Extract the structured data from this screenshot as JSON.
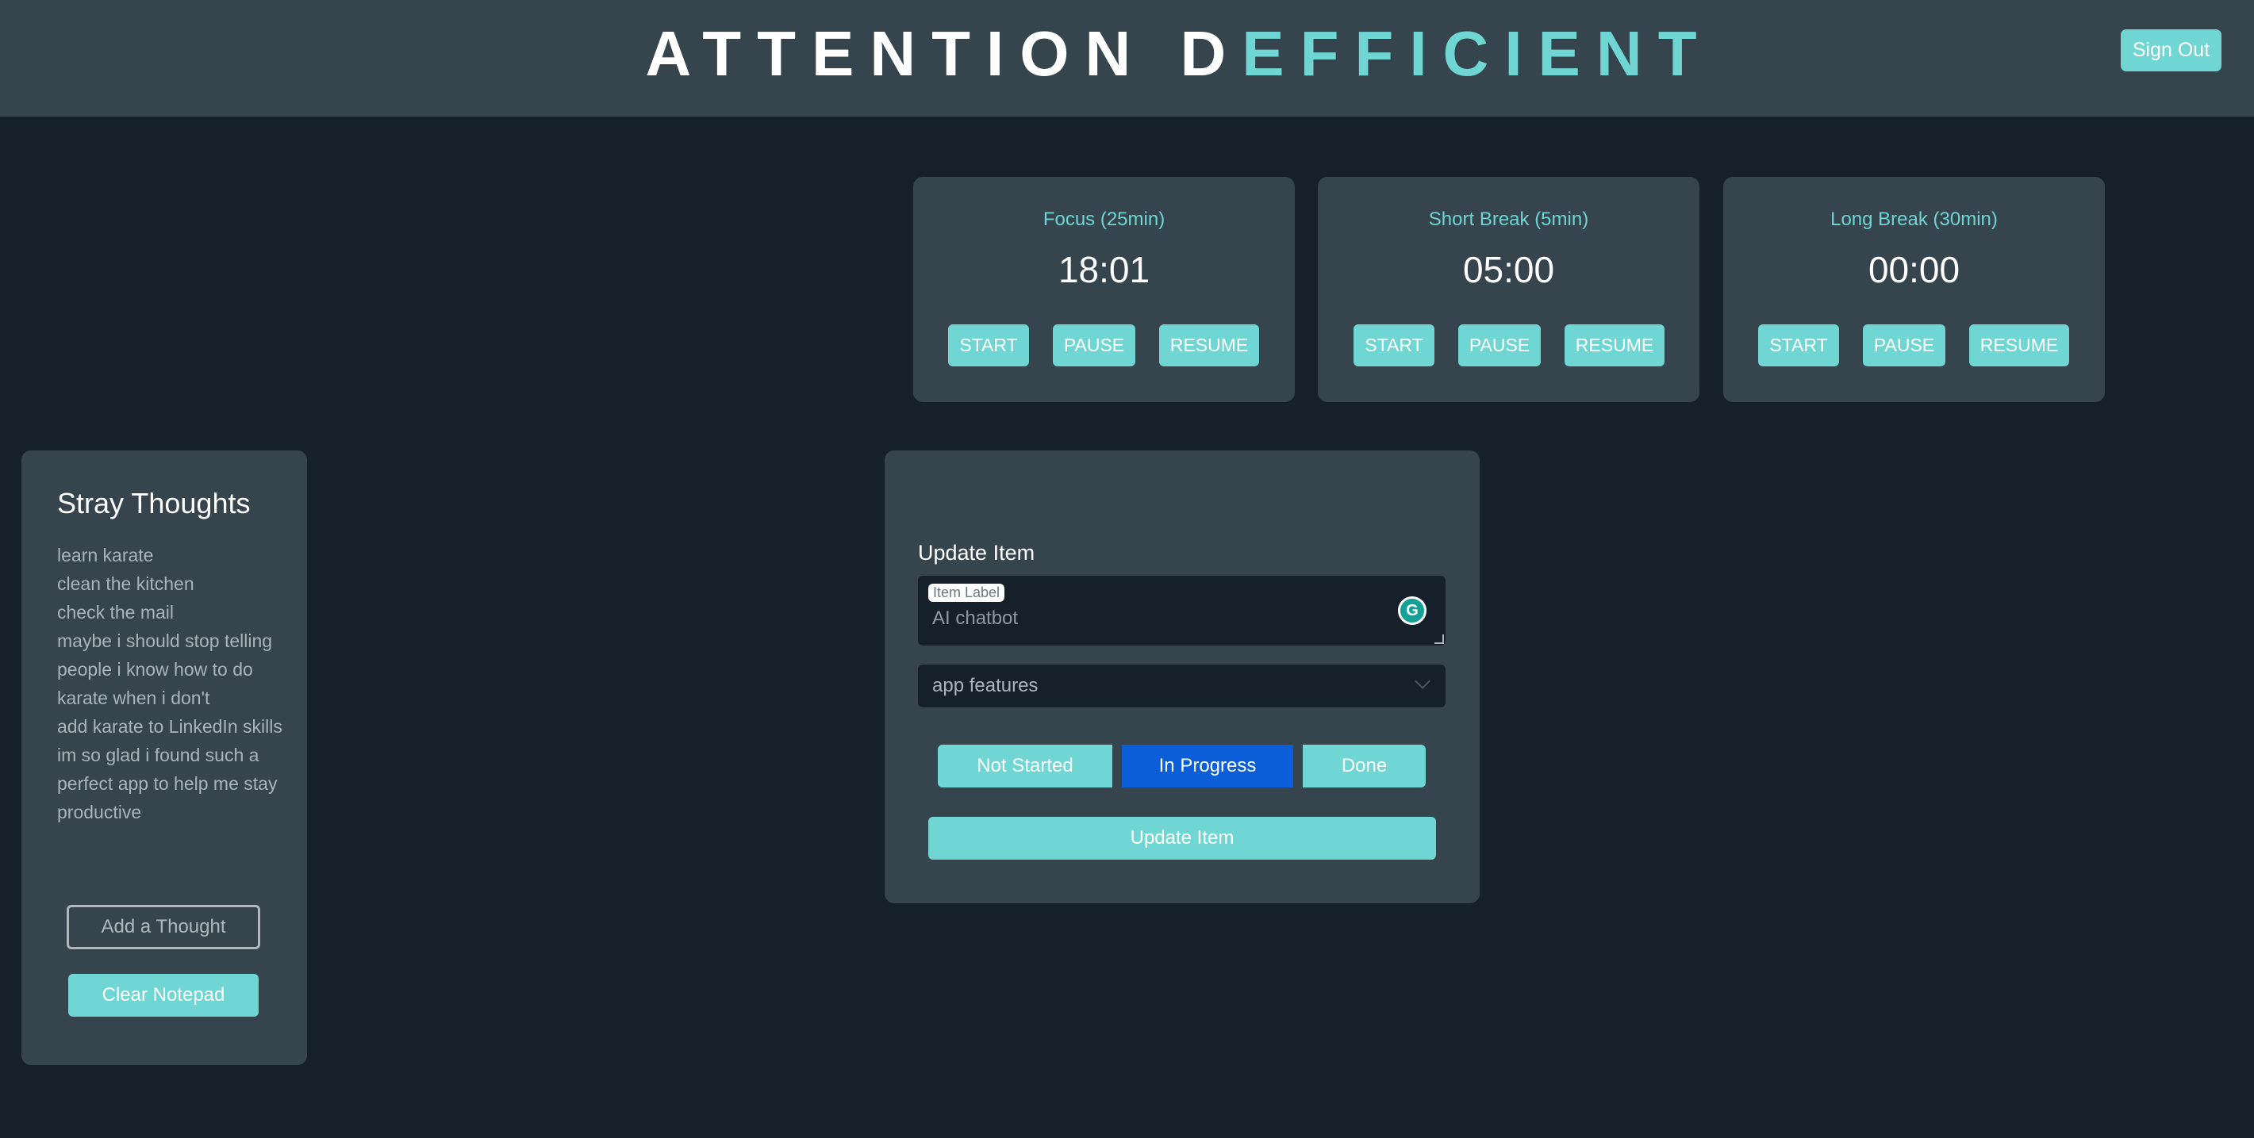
{
  "header": {
    "title_white": "ATTENTION D",
    "title_accent": "EFFICIENT",
    "sign_out_label": "Sign Out"
  },
  "timers": [
    {
      "title": "Focus (25min)",
      "time": "18:01",
      "buttons": [
        "START",
        "PAUSE",
        "RESUME"
      ]
    },
    {
      "title": "Short Break (5min)",
      "time": "05:00",
      "buttons": [
        "START",
        "PAUSE",
        "RESUME"
      ]
    },
    {
      "title": "Long Break (30min)",
      "time": "00:00",
      "buttons": [
        "START",
        "PAUSE",
        "RESUME"
      ]
    }
  ],
  "thoughts": {
    "title": "Stray Thoughts",
    "items": [
      "learn karate",
      "clean the kitchen",
      "check the mail",
      "maybe i should stop telling people i know how to do karate when i don't",
      "add karate to LinkedIn skills",
      "im so glad i found such a perfect app to help me stay productive"
    ],
    "add_label": "Add a Thought",
    "clear_label": "Clear Notepad"
  },
  "update_form": {
    "title": "Update Item",
    "field_label": "Item Label",
    "field_value": "AI chatbot",
    "category_value": "app features",
    "status_buttons": [
      "Not Started",
      "In Progress",
      "Done"
    ],
    "active_status": "In Progress",
    "submit_label": "Update Item"
  },
  "colors": {
    "background": "#15202a",
    "panel": "#35444d",
    "accent": "#6fd6d3",
    "active_status": "#0b5ed7"
  },
  "icons": {
    "grammarly": "grammarly-icon",
    "dropdown": "chevron-down-icon"
  }
}
